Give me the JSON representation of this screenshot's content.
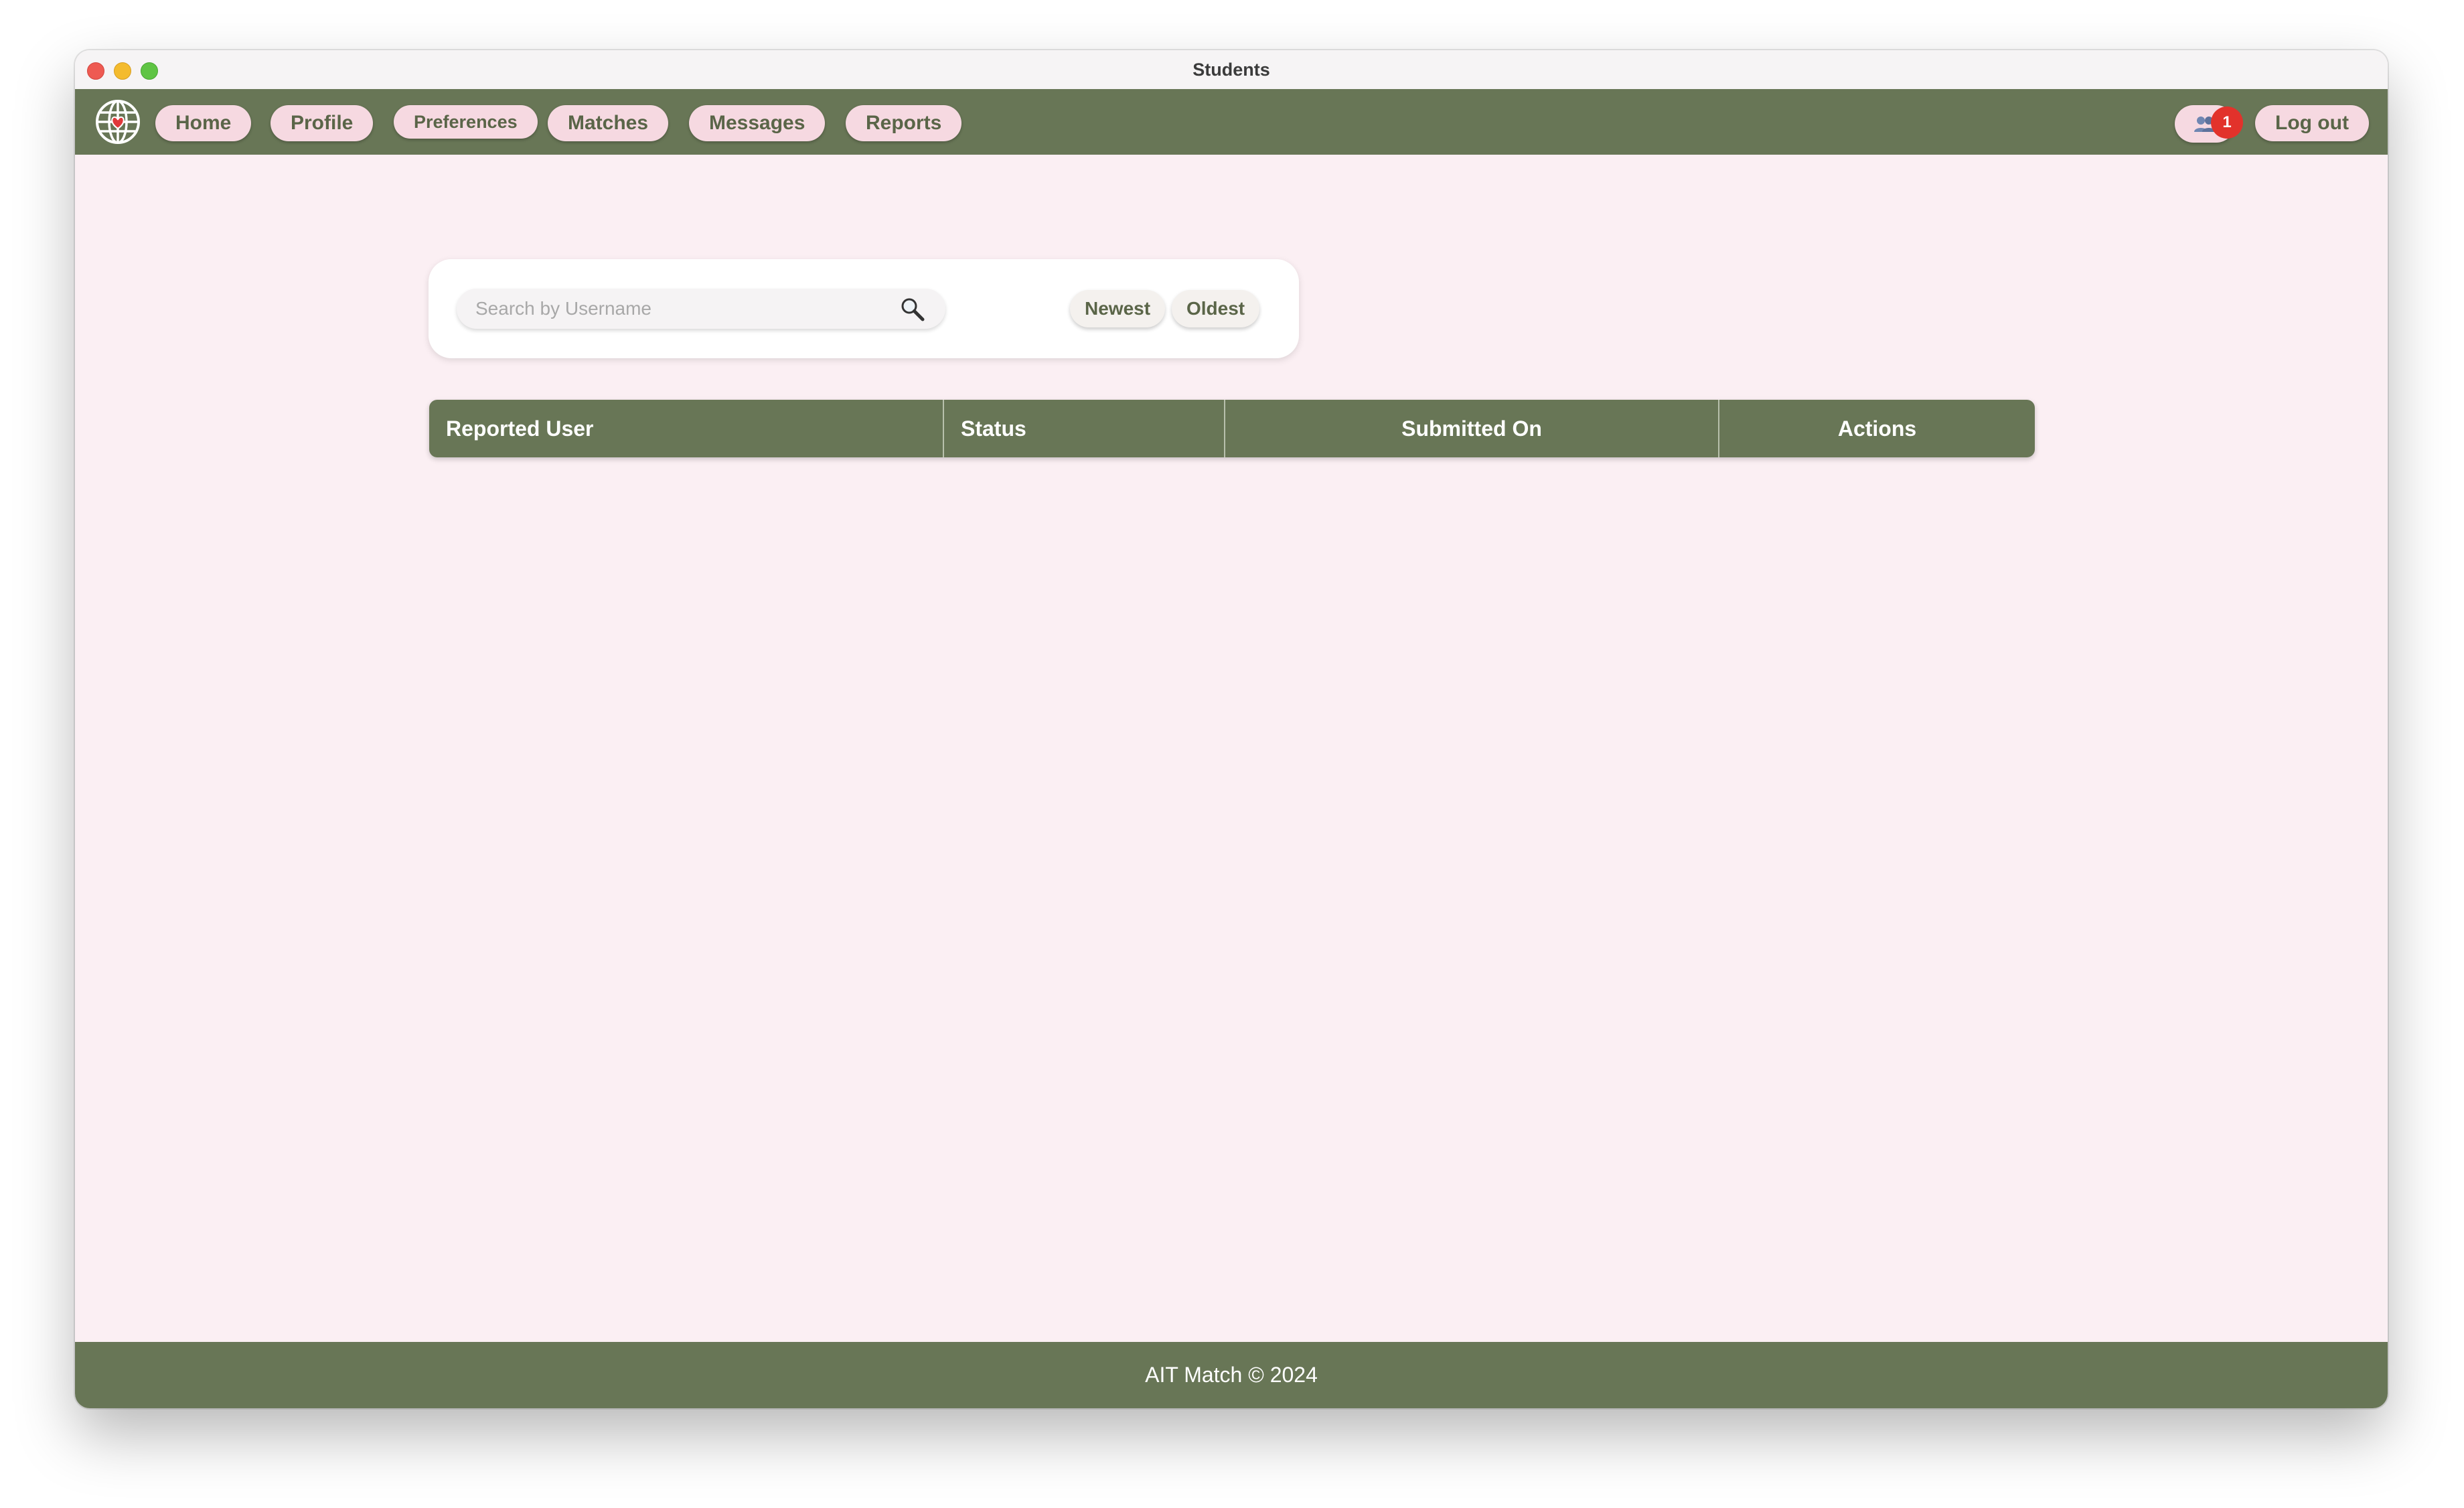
{
  "window": {
    "title": "Students"
  },
  "nav": {
    "items": [
      {
        "label": "Home",
        "name": "nav-home-button"
      },
      {
        "label": "Profile",
        "name": "nav-profile-button"
      },
      {
        "label": "Preferences",
        "name": "nav-preferences-button"
      },
      {
        "label": "Matches",
        "name": "nav-matches-button"
      },
      {
        "label": "Messages",
        "name": "nav-messages-button"
      },
      {
        "label": "Reports",
        "name": "nav-reports-button"
      }
    ],
    "notification_icon": "friends-icon",
    "notification_count": "1",
    "logout_label": "Log out"
  },
  "search": {
    "placeholder": "Search by Username",
    "value": "",
    "icon": "search-icon"
  },
  "sort": {
    "newest_label": "Newest",
    "oldest_label": "Oldest"
  },
  "table": {
    "columns": [
      "Reported User",
      "Status",
      "Submitted On",
      "Actions"
    ],
    "rows": []
  },
  "footer": {
    "text": "AIT Match © 2024"
  },
  "colors": {
    "primary": "#687656",
    "background": "#fbeff3",
    "button_bg": "#f6d9e1",
    "badge": "#e2322b"
  }
}
